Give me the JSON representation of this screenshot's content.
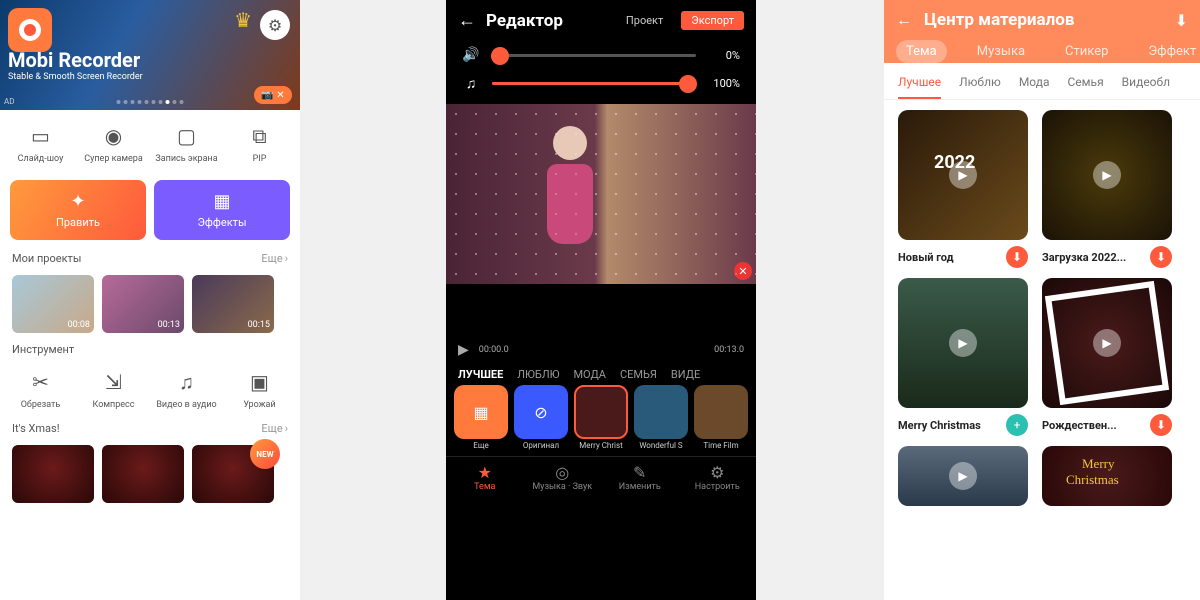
{
  "panel1": {
    "banner": {
      "title": "Mobi Recorder",
      "subtitle": "Stable & Smooth Screen Recorder",
      "ad": "AD"
    },
    "tools_top": [
      {
        "label": "Слайд-шоу"
      },
      {
        "label": "Супер камера"
      },
      {
        "label": "Запись экрана"
      },
      {
        "label": "PIP"
      }
    ],
    "edit_btn": "Править",
    "effects_btn": "Эффекты",
    "projects": {
      "title": "Мои проекты",
      "more": "Еще",
      "items": [
        {
          "dur": "00:08"
        },
        {
          "dur": "00:13"
        },
        {
          "dur": "00:15"
        }
      ]
    },
    "tools_title": "Инструмент",
    "tools_bottom": [
      {
        "label": "Обрезать"
      },
      {
        "label": "Компресс"
      },
      {
        "label": "Видео в аудио"
      },
      {
        "label": "Урожай"
      }
    ],
    "xmas": {
      "title": "It's Xmas!",
      "more": "Еще",
      "new": "NEW"
    }
  },
  "panel2": {
    "title": "Редактор",
    "project": "Проект",
    "export": "Экспорт",
    "vol_speaker": "0%",
    "vol_music": "100%",
    "time_cur": "00:00.0",
    "time_total": "00:13.0",
    "tabs": [
      "ЛУЧШЕЕ",
      "ЛЮБЛЮ",
      "МОДА",
      "СЕМЬЯ",
      "ВИДЕ"
    ],
    "themes": [
      {
        "label": "Еще",
        "bg": "#ff7a3c"
      },
      {
        "label": "Оригинал",
        "bg": "#3a5aff"
      },
      {
        "label": "Merry Christ",
        "bg": "#4a1a1a"
      },
      {
        "label": "Wonderful S",
        "bg": "#2a5a7a"
      },
      {
        "label": "Time Film",
        "bg": "#6a4a2a"
      }
    ],
    "nav": [
      {
        "label": "Тема"
      },
      {
        "label": "Музыка · Звук"
      },
      {
        "label": "Изменить"
      },
      {
        "label": "Настроить"
      }
    ]
  },
  "panel3": {
    "title": "Центр материалов",
    "tabs_a": [
      "Тема",
      "Музыка",
      "Стикер",
      "Эффект"
    ],
    "tabs_b": [
      "Лучшее",
      "Люблю",
      "Мода",
      "Семья",
      "Видеобл"
    ],
    "cards": [
      {
        "cap": "Новый год",
        "dl": "orange",
        "txt": "2022"
      },
      {
        "cap": "Загрузка 2022...",
        "dl": "orange"
      },
      {
        "cap": "Merry Christmas",
        "dl": "teal"
      },
      {
        "cap": "Рождествен...",
        "dl": "orange"
      }
    ],
    "merry": "Merry",
    "christmas": "Christmas"
  }
}
